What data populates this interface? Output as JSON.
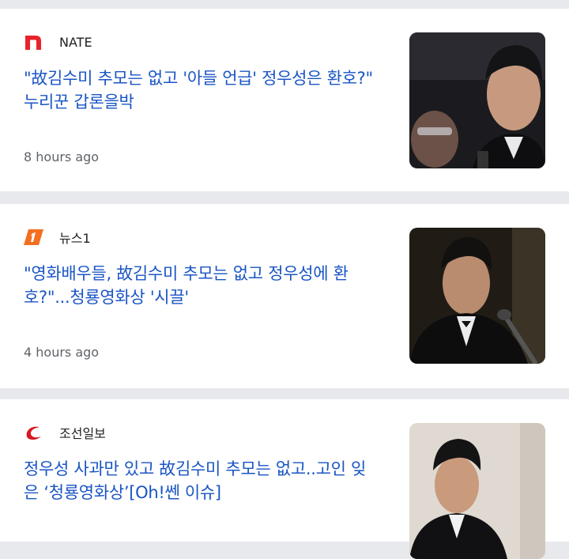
{
  "articles": [
    {
      "source": "NATE",
      "source_logo": "nate-logo",
      "headline": "\"故김수미 추모는 없고 '아들 언급' 정우성은 환호?\" 누리꾼 갑론을박",
      "time": "8 hours ago"
    },
    {
      "source": "뉴스1",
      "source_logo": "news1-logo",
      "headline": "\"영화배우들, 故김수미 추모는 없고 정우성에 환호?\"...청룡영화상 '시끌'",
      "time": "4 hours ago"
    },
    {
      "source": "조선일보",
      "source_logo": "chosun-logo",
      "headline": "정우성 사과만 있고 故김수미 추모는 없고..고인 잊은 ‘청룡영화상’[Oh!쎈 이슈]",
      "time": ""
    }
  ],
  "colors": {
    "headline": "#1a55c4",
    "nate_red": "#e8232a",
    "news1_orange": "#f36f21",
    "chosun_red": "#d71920",
    "background": "#e8e9ec"
  }
}
